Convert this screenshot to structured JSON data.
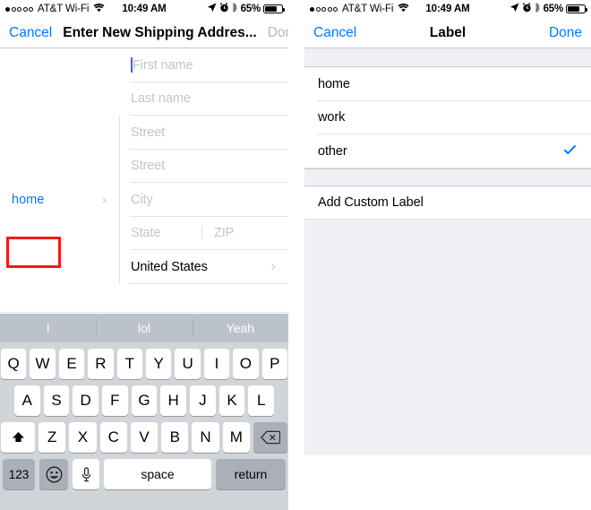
{
  "status_bar": {
    "carrier": "AT&T Wi-Fi",
    "signal_dots_filled": 1,
    "signal_dots_total": 5,
    "wifi_icon": "wifi-icon",
    "time": "10:49 AM",
    "location_icon": "location-arrow-icon",
    "alarm_icon": "alarm-clock-icon",
    "bluetooth_icon": "bluetooth-icon",
    "battery_percent": "65%",
    "battery_level": 65
  },
  "left_panel": {
    "nav": {
      "cancel_label": "Cancel",
      "title": "Enter New Shipping Addres...",
      "done_label": "Done"
    },
    "fields": [
      {
        "placeholder": "First name",
        "value": "",
        "focused": true,
        "type": "text"
      },
      {
        "placeholder": "Last name",
        "value": "",
        "focused": false,
        "type": "text"
      },
      {
        "placeholder": "Street",
        "value": "",
        "focused": false,
        "type": "text"
      },
      {
        "placeholder": "Street",
        "value": "",
        "focused": false,
        "type": "text"
      },
      {
        "placeholder": "City",
        "value": "",
        "focused": false,
        "type": "text"
      }
    ],
    "state_field": {
      "placeholder": "State",
      "value": ""
    },
    "zip_field": {
      "placeholder": "ZIP",
      "value": ""
    },
    "country_row": {
      "value": "United States",
      "chevron": "chevron-right-icon"
    },
    "label_row": {
      "value": "home",
      "chevron": "chevron-right-icon"
    },
    "annotation": {
      "color": "#ee1b1b",
      "target": "home"
    }
  },
  "right_panel": {
    "nav": {
      "cancel_label": "Cancel",
      "title": "Label",
      "done_label": "Done"
    },
    "options": [
      {
        "label": "home",
        "selected": false
      },
      {
        "label": "work",
        "selected": false
      },
      {
        "label": "other",
        "selected": true
      }
    ],
    "add_custom": {
      "label": "Add Custom Label"
    },
    "checkmark_color": "#007aff"
  },
  "keyboard": {
    "suggestions": [
      "I",
      "lol",
      "Yeah"
    ],
    "row1": [
      "Q",
      "W",
      "E",
      "R",
      "T",
      "Y",
      "U",
      "I",
      "O",
      "P"
    ],
    "row2": [
      "A",
      "S",
      "D",
      "F",
      "G",
      "H",
      "J",
      "K",
      "L"
    ],
    "row3": [
      "Z",
      "X",
      "C",
      "V",
      "B",
      "N",
      "M"
    ],
    "shift_icon": "shift-up-arrow-icon",
    "backspace_icon": "backspace-delete-icon",
    "numeric_label": "123",
    "emoji_icon": "smiley-emoji-icon",
    "dictation_icon": "microphone-icon",
    "space_label": "space",
    "return_label": "return"
  },
  "theme": {
    "accent": "#007aff",
    "disabled": "#b9b9bd",
    "placeholder": "#c4c4c8",
    "separator": "#e3e3e6",
    "group_bg": "#efeff4",
    "keyboard_bg": "#d1d5da",
    "suggest_bg": "#bcc2ca",
    "key_gray": "#aab0b8"
  }
}
